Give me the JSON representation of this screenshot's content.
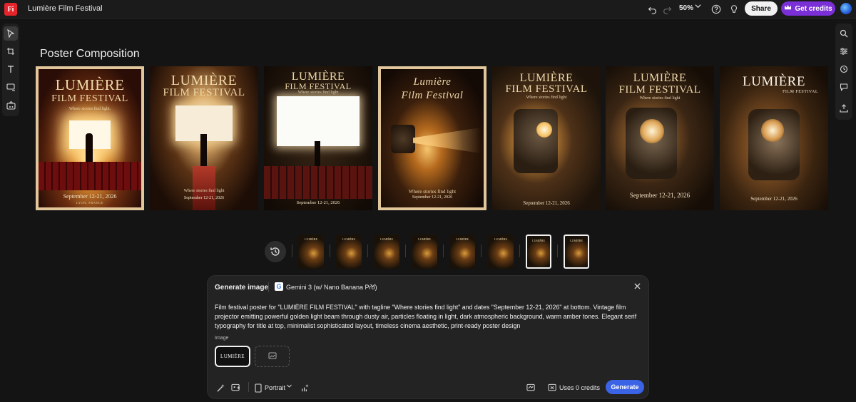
{
  "app": {
    "logo_text": "Fi",
    "document_title": "Lumière Film Festival",
    "zoom": "50%",
    "share_label": "Share",
    "credits_label": "Get credits"
  },
  "canvas": {
    "section_title": "Poster Composition"
  },
  "posters": [
    {
      "title_line1": "LUMIÈRE",
      "title_line2": "FILM FESTIVAL",
      "tagline": "Where stories find light.",
      "date": "September 12-21, 2026",
      "place": "LYON, FRANCE"
    },
    {
      "title_line1": "LUMIÈRE",
      "title_line2": "FILM FESTIVAL",
      "tagline": "Where stories find light",
      "date": "September 12-21, 2026"
    },
    {
      "title_line1": "LUMIÈRE",
      "title_line2": "FILM FESTIVAL",
      "tagline": "Where stories find light",
      "date": "September 12-21, 2026"
    },
    {
      "title_line1": "Lumière",
      "title_line2": "Film Festival",
      "tagline": "Where stories find light",
      "date": "September 12-21, 2026"
    },
    {
      "title_line1": "LUMIÈRE",
      "title_line2": "FILM FESTIVAL",
      "tagline": "Where stories find light",
      "date": "September 12-21, 2026"
    },
    {
      "title_line1": "LUMIÈRE",
      "title_line2": "FILM FESTIVAL",
      "tagline": "Where stories find light",
      "date": "September 12-21, 2026"
    },
    {
      "title_line1": "LUMIÈRE",
      "title_line2": "FILM FESTIVAL",
      "tagline": "",
      "date": "September 12-21, 2026"
    }
  ],
  "thumbnails": [
    {
      "label": "LUMIÈRE"
    },
    {
      "label": "LUMIÈRE"
    },
    {
      "label": "LUMIÈRE"
    },
    {
      "label": "LUMIÈRE"
    },
    {
      "label": "LUMIÈRE"
    },
    {
      "label": "LUMIÈRE"
    },
    {
      "label": "LUMIÈRE"
    },
    {
      "label": "LUMIÈRE"
    }
  ],
  "generate": {
    "title": "Generate image",
    "model_icon": "G",
    "model": "Gemini 3 (w/ Nano Banana Pro)",
    "prompt": "Film festival poster for \"LUMIÈRE FILM FESTIVAL\" with tagline \"Where stories find light\" and dates \"September 12-21, 2026\" at bottom. Vintage film projector emitting powerful golden light beam through dusty air, particles floating in light, dark atmospheric background, warm amber tones. Elegant serif typography for title at top, minimalist sophisticated layout, timeless cinema aesthetic, print-ready poster design",
    "image_label": "Image",
    "reference_image_text": "LUMIÈRE",
    "orientation": "Portrait",
    "uses_credits": "Uses 0 credits",
    "generate_label": "Generate"
  }
}
